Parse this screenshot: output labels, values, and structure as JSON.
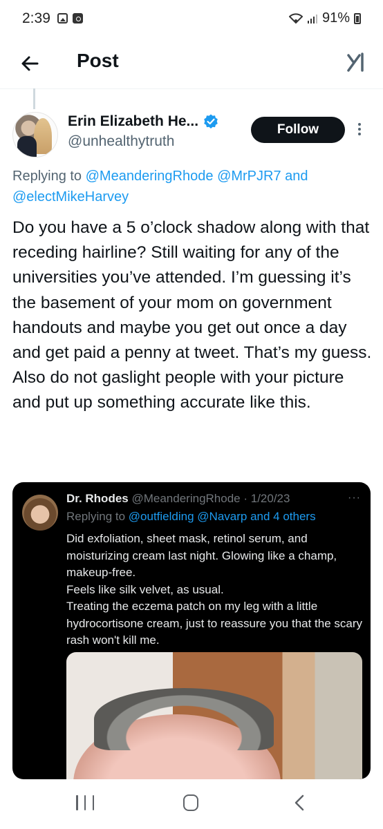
{
  "status_bar": {
    "time": "2:39",
    "battery": "91%"
  },
  "header": {
    "title": "Post"
  },
  "post": {
    "author_name": "Erin Elizabeth He...",
    "author_handle": "@unhealthytruth",
    "follow_label": "Follow",
    "replying_prefix": "Replying to ",
    "mention_1": "@MeanderingRhode",
    "mention_2": "@MrPJR7",
    "replying_and": " and ",
    "mention_3": "@electMikeHarvey",
    "text": "Do you have a 5 o’clock shadow along with that receding  hairline? Still waiting for any of the universities you’ve attended. I’m guessing it’s the basement of your mom on government handouts and maybe you get out once a day and get paid a penny at tweet. That’s my guess. Also do not gaslight people with your picture and put up something accurate like this."
  },
  "quoted": {
    "name": "Dr. Rhodes",
    "handle": "@MeanderingRhode",
    "dot": " · ",
    "date": "1/20/23",
    "more": "···",
    "replying_prefix": "Replying to ",
    "mention_1": "@outfielding",
    "mention_2": "@Navarp and 4 others",
    "text_1": "Did exfoliation, sheet mask, retinol serum, and moisturizing cream last night. Glowing like a champ, makeup-free.",
    "text_2": "Feels like silk velvet, as usual.",
    "text_3": "Treating the eczema patch on my leg with a little hydrocortisone cream, just to reassure you that the scary rash won't kill me."
  },
  "icons": {
    "back": "arrow-left-icon",
    "grok": "grok-icon",
    "verified": "verified-badge-icon",
    "more": "more-vertical-icon",
    "nav_recents": "recents-icon",
    "nav_home": "home-icon",
    "nav_back": "back-chevron-icon"
  },
  "colors": {
    "accent": "#1d9bf0",
    "text": "#0f1419",
    "muted": "#536471",
    "quote_bg": "#000000"
  }
}
